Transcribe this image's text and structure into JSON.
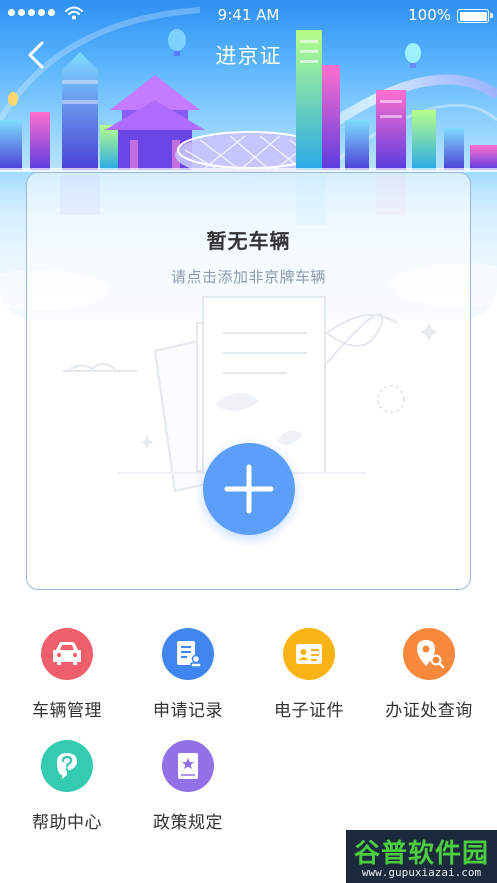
{
  "status_bar": {
    "time": "9:41 AM",
    "battery": "100%",
    "battery_level": 1.0
  },
  "nav": {
    "title": "进京证",
    "back_icon": "chevron-left-icon"
  },
  "vehicle_card": {
    "title": "暂无车辆",
    "subtitle": "请点击添加非京牌车辆",
    "add_icon": "plus-icon"
  },
  "menu": {
    "items": [
      {
        "label": "车辆管理",
        "icon": "car-icon",
        "color": "#f05f6c"
      },
      {
        "label": "申请记录",
        "icon": "document-stamp-icon",
        "color": "#3f86f0"
      },
      {
        "label": "电子证件",
        "icon": "id-card-icon",
        "color": "#f9b315"
      },
      {
        "label": "办证处查询",
        "icon": "location-search-icon",
        "color": "#f7893d"
      },
      {
        "label": "帮助中心",
        "icon": "question-icon",
        "color": "#34cbb0"
      },
      {
        "label": "政策规定",
        "icon": "policy-book-icon",
        "color": "#9271e6"
      }
    ]
  },
  "colors": {
    "accent": "#5b9ffb",
    "header_top": "#2f8ff2",
    "card_border": "#9db8e6"
  },
  "watermark": {
    "name": "谷普软件园",
    "url": "www.gupuxiazai.com"
  }
}
